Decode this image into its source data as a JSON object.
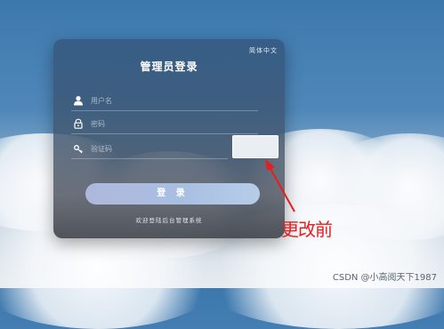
{
  "language_toggle": "简体中文",
  "login": {
    "title": "管理员登录",
    "username_placeholder": "用户名",
    "password_placeholder": "密码",
    "captcha_placeholder": "验证码",
    "submit_label": "登 录",
    "footer_text": "欢迎登陆后台管理系统"
  },
  "annotation": {
    "label": "更改前",
    "color": "#e81d1d"
  },
  "watermark": "CSDN @小高阅天下1987",
  "icons": [
    "user-icon",
    "lock-icon",
    "key-icon"
  ]
}
